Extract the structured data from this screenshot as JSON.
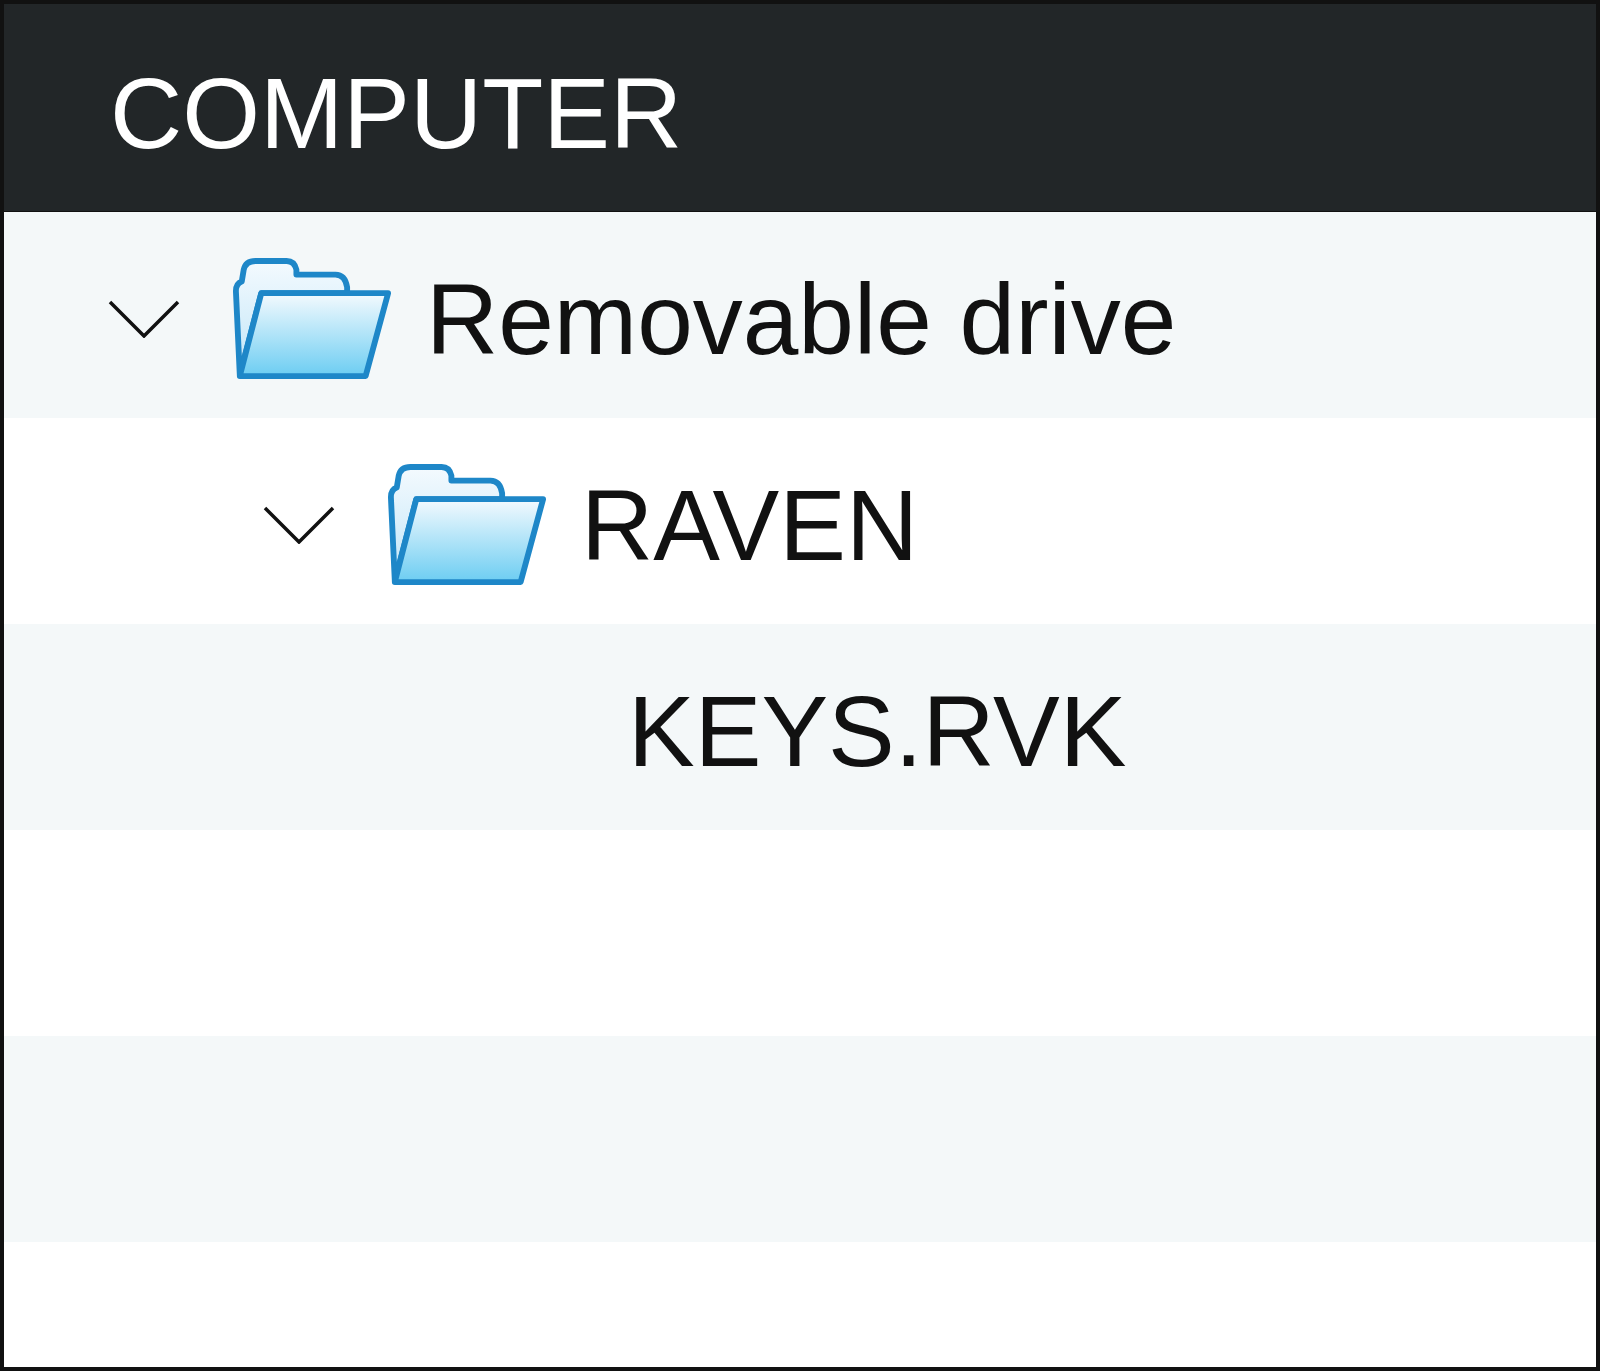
{
  "header": {
    "title": "COMPUTER"
  },
  "tree": [
    {
      "kind": "folder",
      "label": "Removable drive",
      "expanded": true,
      "children": [
        {
          "kind": "folder",
          "label": "RAVEN",
          "expanded": true,
          "children": [
            {
              "kind": "file",
              "label": "KEYS.RVK"
            }
          ]
        }
      ]
    }
  ]
}
